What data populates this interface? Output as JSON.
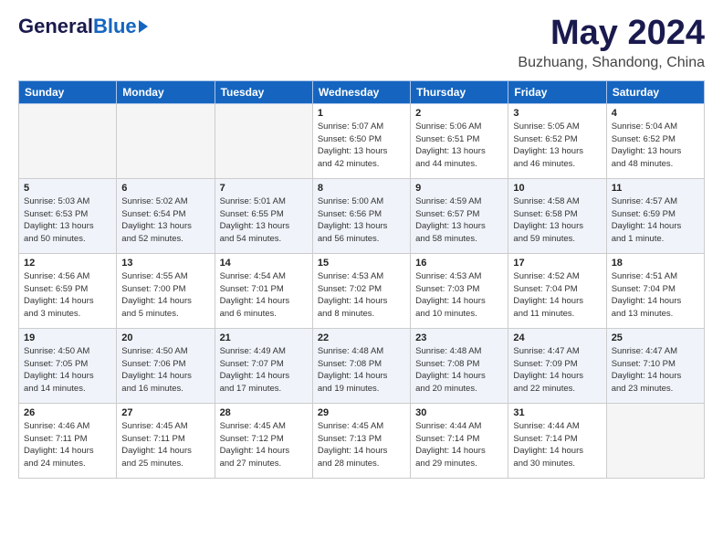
{
  "header": {
    "logo_general": "General",
    "logo_blue": "Blue",
    "title": "May 2024",
    "subtitle": "Buzhuang, Shandong, China"
  },
  "weekdays": [
    "Sunday",
    "Monday",
    "Tuesday",
    "Wednesday",
    "Thursday",
    "Friday",
    "Saturday"
  ],
  "weeks": [
    [
      {
        "day": "",
        "info": ""
      },
      {
        "day": "",
        "info": ""
      },
      {
        "day": "",
        "info": ""
      },
      {
        "day": "1",
        "info": "Sunrise: 5:07 AM\nSunset: 6:50 PM\nDaylight: 13 hours\nand 42 minutes."
      },
      {
        "day": "2",
        "info": "Sunrise: 5:06 AM\nSunset: 6:51 PM\nDaylight: 13 hours\nand 44 minutes."
      },
      {
        "day": "3",
        "info": "Sunrise: 5:05 AM\nSunset: 6:52 PM\nDaylight: 13 hours\nand 46 minutes."
      },
      {
        "day": "4",
        "info": "Sunrise: 5:04 AM\nSunset: 6:52 PM\nDaylight: 13 hours\nand 48 minutes."
      }
    ],
    [
      {
        "day": "5",
        "info": "Sunrise: 5:03 AM\nSunset: 6:53 PM\nDaylight: 13 hours\nand 50 minutes."
      },
      {
        "day": "6",
        "info": "Sunrise: 5:02 AM\nSunset: 6:54 PM\nDaylight: 13 hours\nand 52 minutes."
      },
      {
        "day": "7",
        "info": "Sunrise: 5:01 AM\nSunset: 6:55 PM\nDaylight: 13 hours\nand 54 minutes."
      },
      {
        "day": "8",
        "info": "Sunrise: 5:00 AM\nSunset: 6:56 PM\nDaylight: 13 hours\nand 56 minutes."
      },
      {
        "day": "9",
        "info": "Sunrise: 4:59 AM\nSunset: 6:57 PM\nDaylight: 13 hours\nand 58 minutes."
      },
      {
        "day": "10",
        "info": "Sunrise: 4:58 AM\nSunset: 6:58 PM\nDaylight: 13 hours\nand 59 minutes."
      },
      {
        "day": "11",
        "info": "Sunrise: 4:57 AM\nSunset: 6:59 PM\nDaylight: 14 hours\nand 1 minute."
      }
    ],
    [
      {
        "day": "12",
        "info": "Sunrise: 4:56 AM\nSunset: 6:59 PM\nDaylight: 14 hours\nand 3 minutes."
      },
      {
        "day": "13",
        "info": "Sunrise: 4:55 AM\nSunset: 7:00 PM\nDaylight: 14 hours\nand 5 minutes."
      },
      {
        "day": "14",
        "info": "Sunrise: 4:54 AM\nSunset: 7:01 PM\nDaylight: 14 hours\nand 6 minutes."
      },
      {
        "day": "15",
        "info": "Sunrise: 4:53 AM\nSunset: 7:02 PM\nDaylight: 14 hours\nand 8 minutes."
      },
      {
        "day": "16",
        "info": "Sunrise: 4:53 AM\nSunset: 7:03 PM\nDaylight: 14 hours\nand 10 minutes."
      },
      {
        "day": "17",
        "info": "Sunrise: 4:52 AM\nSunset: 7:04 PM\nDaylight: 14 hours\nand 11 minutes."
      },
      {
        "day": "18",
        "info": "Sunrise: 4:51 AM\nSunset: 7:04 PM\nDaylight: 14 hours\nand 13 minutes."
      }
    ],
    [
      {
        "day": "19",
        "info": "Sunrise: 4:50 AM\nSunset: 7:05 PM\nDaylight: 14 hours\nand 14 minutes."
      },
      {
        "day": "20",
        "info": "Sunrise: 4:50 AM\nSunset: 7:06 PM\nDaylight: 14 hours\nand 16 minutes."
      },
      {
        "day": "21",
        "info": "Sunrise: 4:49 AM\nSunset: 7:07 PM\nDaylight: 14 hours\nand 17 minutes."
      },
      {
        "day": "22",
        "info": "Sunrise: 4:48 AM\nSunset: 7:08 PM\nDaylight: 14 hours\nand 19 minutes."
      },
      {
        "day": "23",
        "info": "Sunrise: 4:48 AM\nSunset: 7:08 PM\nDaylight: 14 hours\nand 20 minutes."
      },
      {
        "day": "24",
        "info": "Sunrise: 4:47 AM\nSunset: 7:09 PM\nDaylight: 14 hours\nand 22 minutes."
      },
      {
        "day": "25",
        "info": "Sunrise: 4:47 AM\nSunset: 7:10 PM\nDaylight: 14 hours\nand 23 minutes."
      }
    ],
    [
      {
        "day": "26",
        "info": "Sunrise: 4:46 AM\nSunset: 7:11 PM\nDaylight: 14 hours\nand 24 minutes."
      },
      {
        "day": "27",
        "info": "Sunrise: 4:45 AM\nSunset: 7:11 PM\nDaylight: 14 hours\nand 25 minutes."
      },
      {
        "day": "28",
        "info": "Sunrise: 4:45 AM\nSunset: 7:12 PM\nDaylight: 14 hours\nand 27 minutes."
      },
      {
        "day": "29",
        "info": "Sunrise: 4:45 AM\nSunset: 7:13 PM\nDaylight: 14 hours\nand 28 minutes."
      },
      {
        "day": "30",
        "info": "Sunrise: 4:44 AM\nSunset: 7:14 PM\nDaylight: 14 hours\nand 29 minutes."
      },
      {
        "day": "31",
        "info": "Sunrise: 4:44 AM\nSunset: 7:14 PM\nDaylight: 14 hours\nand 30 minutes."
      },
      {
        "day": "",
        "info": ""
      }
    ]
  ]
}
